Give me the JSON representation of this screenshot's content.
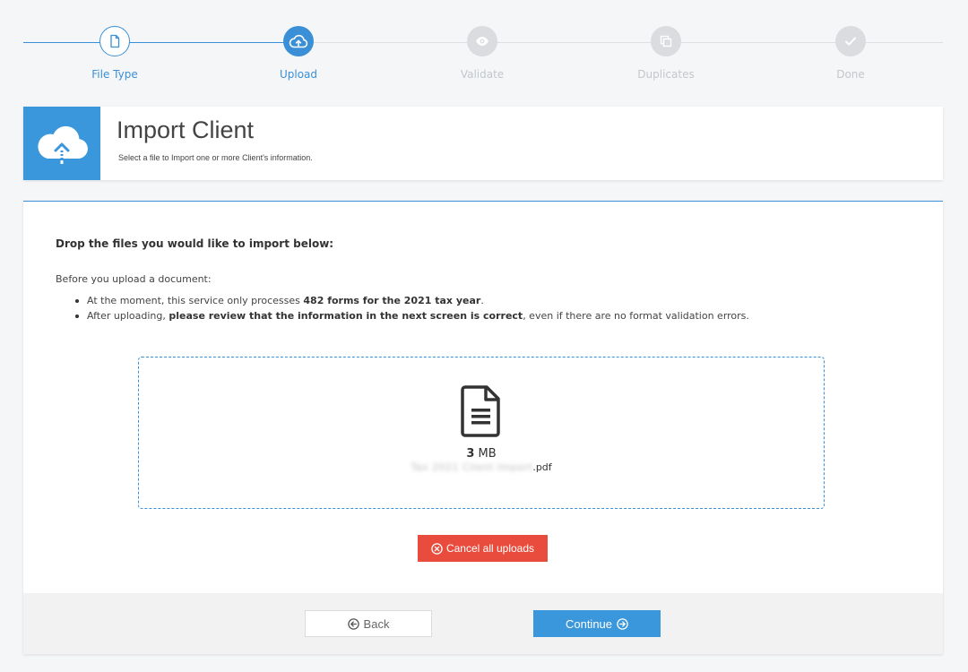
{
  "stepper": {
    "steps": [
      {
        "label": "File Type",
        "state": "completed",
        "icon": "file-icon"
      },
      {
        "label": "Upload",
        "state": "current",
        "icon": "cloud-upload-icon"
      },
      {
        "label": "Validate",
        "state": "pending",
        "icon": "eye-icon"
      },
      {
        "label": "Duplicates",
        "state": "pending",
        "icon": "copy-icon"
      },
      {
        "label": "Done",
        "state": "pending",
        "icon": "check-icon"
      }
    ]
  },
  "header": {
    "title": "Import Client",
    "subtitle": "Select a file to Import one or more Client's information.",
    "icon": "cloud-upload-icon"
  },
  "main": {
    "heading": "Drop the files you would like to import below:",
    "intro": "Before you upload a document:",
    "rules": [
      {
        "pre": "At the moment, this service only processes ",
        "bold": "482 forms for the 2021 tax year",
        "post": "."
      },
      {
        "pre": "After uploading, ",
        "bold": "please review that the information in the next screen is correct",
        "post": ", even if there are no format validation errors."
      }
    ]
  },
  "dropzone": {
    "file": {
      "size_value": "3",
      "size_unit": "MB",
      "name_redacted": "Tax 2021 Client Import",
      "extension": ".pdf",
      "icon": "document-icon"
    }
  },
  "actions": {
    "cancel_label": "Cancel all uploads",
    "back_label": "Back",
    "continue_label": "Continue"
  },
  "colors": {
    "accent": "#3a97dc",
    "danger": "#e94c3d",
    "pending": "#dadcdf"
  }
}
